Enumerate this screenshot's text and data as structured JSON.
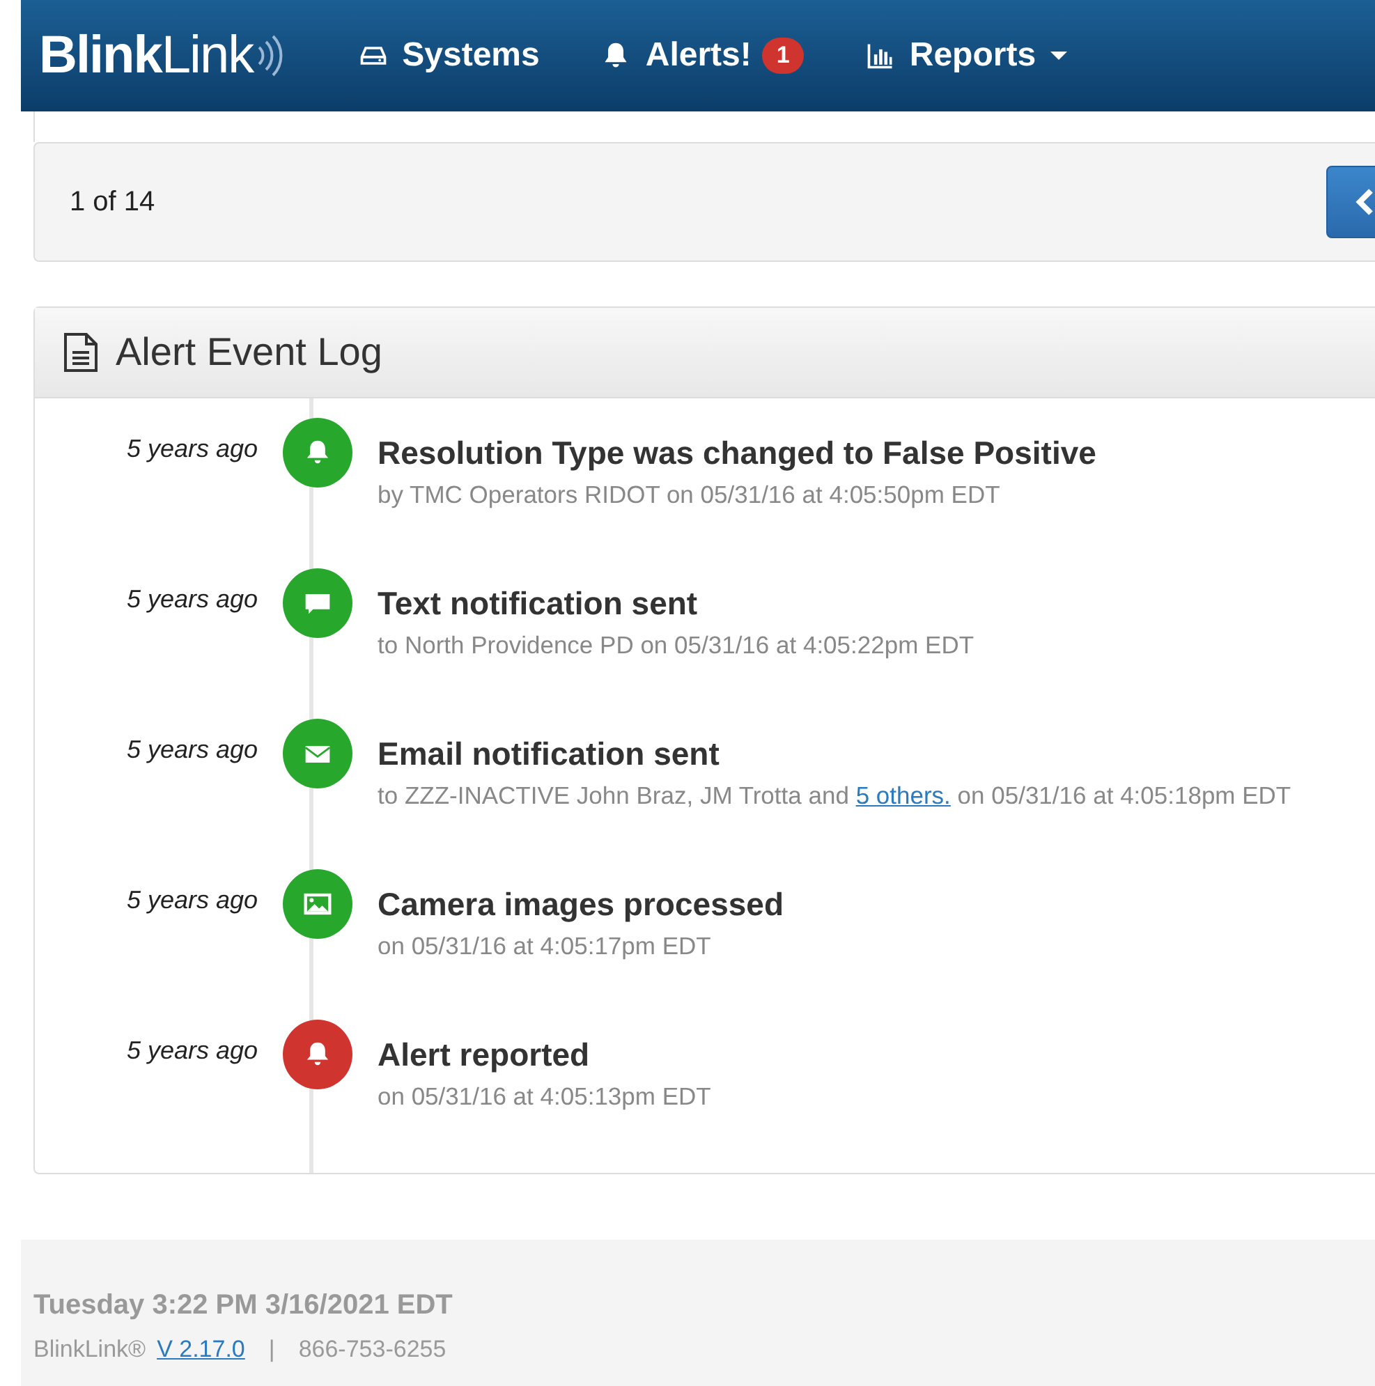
{
  "navbar": {
    "logo": "**Blink**Link",
    "items": [
      {
        "kind": "systems",
        "label": "Systems"
      },
      {
        "kind": "alerts",
        "label": "Alerts!",
        "badge": "1"
      },
      {
        "kind": "reports",
        "label": "Reports"
      }
    ]
  },
  "pager": {
    "text": "1 of 14"
  },
  "event_log": {
    "title": "Alert Event Log",
    "events": [
      {
        "time": "5 years ago",
        "kind": "bell",
        "color": "#27a82d",
        "title": "Resolution Type was changed to False Positive",
        "detail": "by TMC Operators RIDOT on 05/31/16 at 4:05:50pm EDT"
      },
      {
        "time": "5 years ago",
        "kind": "comment",
        "color": "#27a82d",
        "title": "Text notification sent",
        "detail": "to North Providence PD on 05/31/16 at 4:05:22pm EDT"
      },
      {
        "time": "5 years ago",
        "kind": "envelope",
        "color": "#27a82d",
        "title": "Email notification sent",
        "detail": "to ZZZ-INACTIVE John Braz, JM Trotta and",
        "link": "5 others.",
        "detail_after": "on 05/31/16 at 4:05:18pm EDT"
      },
      {
        "time": "5 years ago",
        "kind": "picture",
        "color": "#27a82d",
        "title": "Camera images processed",
        "detail": "on 05/31/16 at 4:05:17pm EDT"
      },
      {
        "time": "5 years ago",
        "kind": "bell",
        "color": "#d0342f",
        "title": "Alert reported",
        "detail": "on 05/31/16 at 4:05:13pm EDT"
      }
    ]
  },
  "footer": {
    "datetime": "Tuesday 3:22 PM 3/16/2021 EDT",
    "product": "BlinkLink®",
    "version": "V 2.17.0",
    "separator": "|",
    "phone": "866-753-6255"
  }
}
